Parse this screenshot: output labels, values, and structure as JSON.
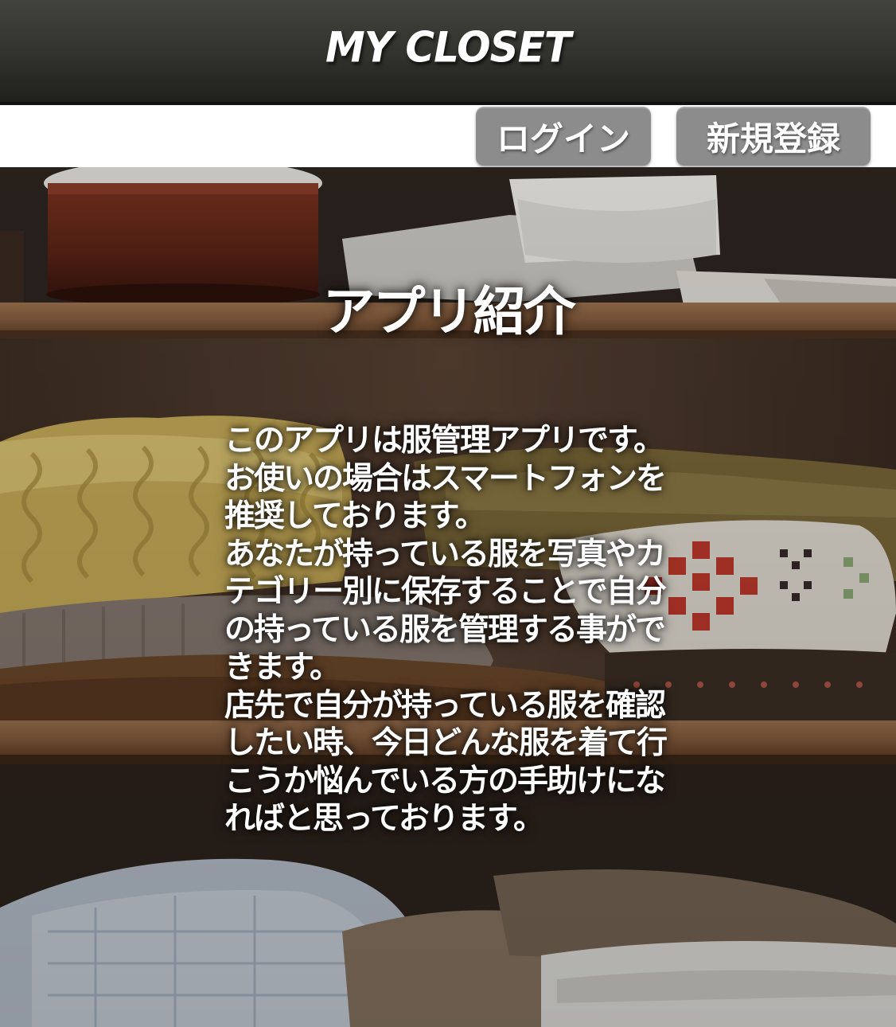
{
  "header": {
    "logo": "My Closet"
  },
  "auth": {
    "login_label": "ログイン",
    "signup_label": "新規登録"
  },
  "hero": {
    "title": "アプリ紹介",
    "description": "このアプリは服管理アプリです。\nお使いの場合はスマートフォンを推奨しております。\nあなたが持っている服を写真やカテゴリー別に保存することで自分の持っている服を管理する事ができます。\n店先で自分が持っている服を確認したい時、今日どんな服を着て行こうか悩んでいる方の手助けになればと思っております。"
  },
  "colors": {
    "header_bg": "#33332e",
    "button_bg": "#8c8c8c",
    "text": "#ffffff"
  },
  "icons": {
    "background": "closet-photo"
  }
}
